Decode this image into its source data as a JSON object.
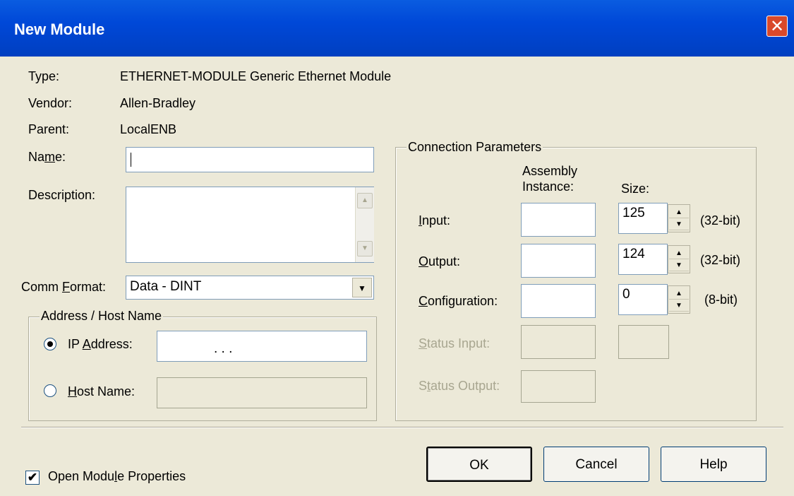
{
  "window": {
    "title": "New Module",
    "close_glyph": "✕"
  },
  "info": {
    "type_label": "Type:",
    "type_value": "ETHERNET-MODULE Generic Ethernet Module",
    "vendor_label": "Vendor:",
    "vendor_value": "Allen-Bradley",
    "parent_label": "Parent:",
    "parent_value": "LocalENB"
  },
  "name": {
    "label_pre": "Na",
    "label_u": "m",
    "label_post": "e:",
    "value": ""
  },
  "description": {
    "label_pre": "Description",
    "label_u": "",
    "label_post": ":",
    "value": ""
  },
  "comm_format": {
    "label_pre": "Comm ",
    "label_u": "F",
    "label_post": "ormat:",
    "value": "Data - DINT"
  },
  "address": {
    "group_label": "Address / Host Name",
    "ip_label_pre": "IP ",
    "ip_label_u": "A",
    "ip_label_post": "ddress:",
    "ip_value": ".           .           .",
    "ip_selected": true,
    "host_label_u": "H",
    "host_label_post": "ost Name:",
    "host_value": ""
  },
  "connection": {
    "group_label": "Connection Parameters",
    "col_assembly": "Assembly\nInstance:",
    "col_assembly_1": "Assembly",
    "col_assembly_2": "Instance:",
    "col_size": "Size:",
    "rows": [
      {
        "label_u": "I",
        "label_post": "nput:",
        "instance": "",
        "size": "125",
        "unit": "(32-bit)",
        "enabled": true
      },
      {
        "label_u": "O",
        "label_post": "utput:",
        "instance": "",
        "size": "124",
        "unit": "(32-bit)",
        "enabled": true
      },
      {
        "label_u": "C",
        "label_post": "onfiguration:",
        "instance": "",
        "size": "0",
        "unit": "(8-bit)",
        "enabled": true
      },
      {
        "label_u": "S",
        "label_post": "tatus Input:",
        "instance": "",
        "size": "",
        "unit": "",
        "enabled": false
      },
      {
        "label_u": "",
        "label_pre": "Status Output:",
        "instance": "",
        "enabled": false
      }
    ],
    "status_output_pre": "S",
    "status_output_u": "t",
    "status_output_post": "atus Output:"
  },
  "footer": {
    "open_props_label_pre": "Open Modu",
    "open_props_label_u": "l",
    "open_props_label_post": "e Properties",
    "open_props_checked": true,
    "ok": "OK",
    "cancel": "Cancel",
    "help": "Help"
  }
}
